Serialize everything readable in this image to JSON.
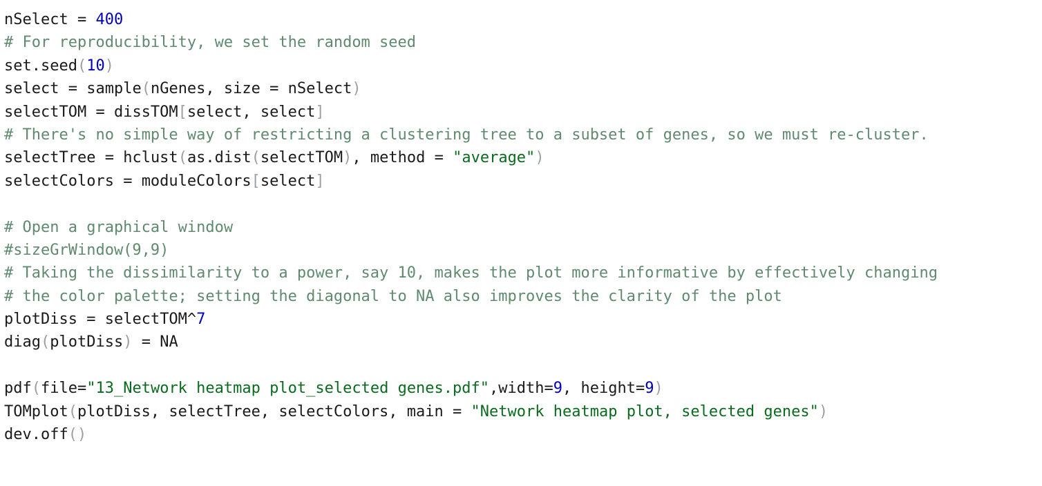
{
  "editor": {
    "language": "R",
    "background_color": "#ffffff",
    "font_size_px": 22,
    "line_height_px": 33.4
  },
  "colors": {
    "plain": "#1a1a1a",
    "comment": "#5f8a6e",
    "string": "#0a6b1e",
    "number": "#0000bb",
    "constant": "#5b5bdd",
    "paren": "#9aa0a6",
    "operator": "#6e7479"
  },
  "code": {
    "full_text": "nSelect = 400\n# For reproducibility, we set the random seed\nset.seed(10)\nselect = sample(nGenes, size = nSelect)\nselectTOM = dissTOM[select, select]\n# There's no simple way of restricting a clustering tree to a subset of genes, so we must re-cluster.\nselectTree = hclust(as.dist(selectTOM), method = \"average\")\nselectColors = moduleColors[select]\n\n# Open a graphical window\n#sizeGrWindow(9,9)\n# Taking the dissimilarity to a power, say 10, makes the plot more informative by effectively changing\n# the color palette; setting the diagonal to NA also improves the clarity of the plot\nplotDiss = selectTOM^7\ndiag(plotDiss) = NA\n\npdf(file=\"13_Network heatmap plot_selected genes.pdf\",width=9, height=9)\nTOMplot(plotDiss, selectTree, selectColors, main = \"Network heatmap plot, selected genes\")\ndev.off()",
    "lines": [
      {
        "index": 1,
        "text": "nSelect = 400",
        "tokens": [
          {
            "t": "nSelect ",
            "c": "plain"
          },
          {
            "t": "= ",
            "c": "operator"
          },
          {
            "t": "400",
            "c": "number"
          }
        ]
      },
      {
        "index": 2,
        "text": "# For reproducibility, we set the random seed",
        "tokens": [
          {
            "t": "# For reproducibility, we set the random seed",
            "c": "comment"
          }
        ]
      },
      {
        "index": 3,
        "text": "set.seed(10)",
        "tokens": [
          {
            "t": "set.seed",
            "c": "plain"
          },
          {
            "t": "(",
            "c": "paren"
          },
          {
            "t": "10",
            "c": "number"
          },
          {
            "t": ")",
            "c": "paren"
          }
        ]
      },
      {
        "index": 4,
        "text": "select = sample(nGenes, size = nSelect)",
        "tokens": [
          {
            "t": "select ",
            "c": "plain"
          },
          {
            "t": "= ",
            "c": "operator"
          },
          {
            "t": "sample",
            "c": "plain"
          },
          {
            "t": "(",
            "c": "paren"
          },
          {
            "t": "nGenes, size ",
            "c": "plain"
          },
          {
            "t": "= ",
            "c": "operator"
          },
          {
            "t": "nSelect",
            "c": "plain"
          },
          {
            "t": ")",
            "c": "paren"
          }
        ]
      },
      {
        "index": 5,
        "text": "selectTOM = dissTOM[select, select]",
        "tokens": [
          {
            "t": "selectTOM ",
            "c": "plain"
          },
          {
            "t": "= ",
            "c": "operator"
          },
          {
            "t": "dissTOM",
            "c": "plain"
          },
          {
            "t": "[",
            "c": "paren"
          },
          {
            "t": "select, select",
            "c": "plain"
          },
          {
            "t": "]",
            "c": "paren"
          }
        ]
      },
      {
        "index": 6,
        "text": "# There's no simple way of restricting a clustering tree to a subset of genes, so we must re-cluster.",
        "tokens": [
          {
            "t": "# There's no simple way of restricting a clustering tree to a subset of genes, so we must re-cluster.",
            "c": "comment"
          }
        ]
      },
      {
        "index": 7,
        "text": "selectTree = hclust(as.dist(selectTOM), method = \"average\")",
        "tokens": [
          {
            "t": "selectTree ",
            "c": "plain"
          },
          {
            "t": "= ",
            "c": "operator"
          },
          {
            "t": "hclust",
            "c": "plain"
          },
          {
            "t": "(",
            "c": "paren"
          },
          {
            "t": "as.dist",
            "c": "plain"
          },
          {
            "t": "(",
            "c": "paren"
          },
          {
            "t": "selectTOM",
            "c": "plain"
          },
          {
            "t": ")",
            "c": "paren"
          },
          {
            "t": ", method ",
            "c": "plain"
          },
          {
            "t": "= ",
            "c": "operator"
          },
          {
            "t": "\"average\"",
            "c": "string"
          },
          {
            "t": ")",
            "c": "paren"
          }
        ]
      },
      {
        "index": 8,
        "text": "selectColors = moduleColors[select]",
        "tokens": [
          {
            "t": "selectColors ",
            "c": "plain"
          },
          {
            "t": "= ",
            "c": "operator"
          },
          {
            "t": "moduleColors",
            "c": "plain"
          },
          {
            "t": "[",
            "c": "paren"
          },
          {
            "t": "select",
            "c": "plain"
          },
          {
            "t": "]",
            "c": "paren"
          }
        ]
      },
      {
        "index": 9,
        "text": "",
        "tokens": []
      },
      {
        "index": 10,
        "text": "# Open a graphical window",
        "tokens": [
          {
            "t": "# Open a graphical window",
            "c": "comment"
          }
        ]
      },
      {
        "index": 11,
        "text": "#sizeGrWindow(9,9)",
        "tokens": [
          {
            "t": "#sizeGrWindow(9,9)",
            "c": "comment"
          }
        ]
      },
      {
        "index": 12,
        "text": "# Taking the dissimilarity to a power, say 10, makes the plot more informative by effectively changing",
        "tokens": [
          {
            "t": "# Taking the dissimilarity to a power, say 10, makes the plot more informative by effectively changing",
            "c": "comment"
          }
        ]
      },
      {
        "index": 13,
        "text": "# the color palette; setting the diagonal to NA also improves the clarity of the plot",
        "tokens": [
          {
            "t": "# the color palette; setting the diagonal to NA also improves the clarity of the plot",
            "c": "comment"
          }
        ]
      },
      {
        "index": 14,
        "text": "plotDiss = selectTOM^7",
        "tokens": [
          {
            "t": "plotDiss ",
            "c": "plain"
          },
          {
            "t": "= ",
            "c": "operator"
          },
          {
            "t": "selectTOM^",
            "c": "plain"
          },
          {
            "t": "7",
            "c": "number"
          }
        ]
      },
      {
        "index": 15,
        "text": "diag(plotDiss) = NA",
        "tokens": [
          {
            "t": "diag",
            "c": "plain"
          },
          {
            "t": "(",
            "c": "paren"
          },
          {
            "t": "plotDiss",
            "c": "plain"
          },
          {
            "t": ")",
            "c": "paren"
          },
          {
            "t": " ",
            "c": "plain"
          },
          {
            "t": "= ",
            "c": "operator"
          },
          {
            "t": "NA",
            "c": "constant"
          }
        ]
      },
      {
        "index": 16,
        "text": "",
        "tokens": []
      },
      {
        "index": 17,
        "text": "pdf(file=\"13_Network heatmap plot_selected genes.pdf\",width=9, height=9)",
        "tokens": [
          {
            "t": "pdf",
            "c": "plain"
          },
          {
            "t": "(",
            "c": "paren"
          },
          {
            "t": "file",
            "c": "plain"
          },
          {
            "t": "=",
            "c": "operator"
          },
          {
            "t": "\"13_Network heatmap plot_selected genes.pdf\"",
            "c": "string"
          },
          {
            "t": ",width",
            "c": "plain"
          },
          {
            "t": "=",
            "c": "operator"
          },
          {
            "t": "9",
            "c": "number"
          },
          {
            "t": ", height",
            "c": "plain"
          },
          {
            "t": "=",
            "c": "operator"
          },
          {
            "t": "9",
            "c": "number"
          },
          {
            "t": ")",
            "c": "paren"
          }
        ]
      },
      {
        "index": 18,
        "text": "TOMplot(plotDiss, selectTree, selectColors, main = \"Network heatmap plot, selected genes\")",
        "tokens": [
          {
            "t": "TOMplot",
            "c": "plain"
          },
          {
            "t": "(",
            "c": "paren"
          },
          {
            "t": "plotDiss, selectTree, selectColors, main ",
            "c": "plain"
          },
          {
            "t": "= ",
            "c": "operator"
          },
          {
            "t": "\"Network heatmap plot, selected genes\"",
            "c": "string"
          },
          {
            "t": ")",
            "c": "paren"
          }
        ]
      },
      {
        "index": 19,
        "text": "dev.off()",
        "tokens": [
          {
            "t": "dev.off",
            "c": "plain"
          },
          {
            "t": "(",
            "c": "paren"
          },
          {
            "t": ")",
            "c": "paren"
          }
        ]
      }
    ]
  }
}
